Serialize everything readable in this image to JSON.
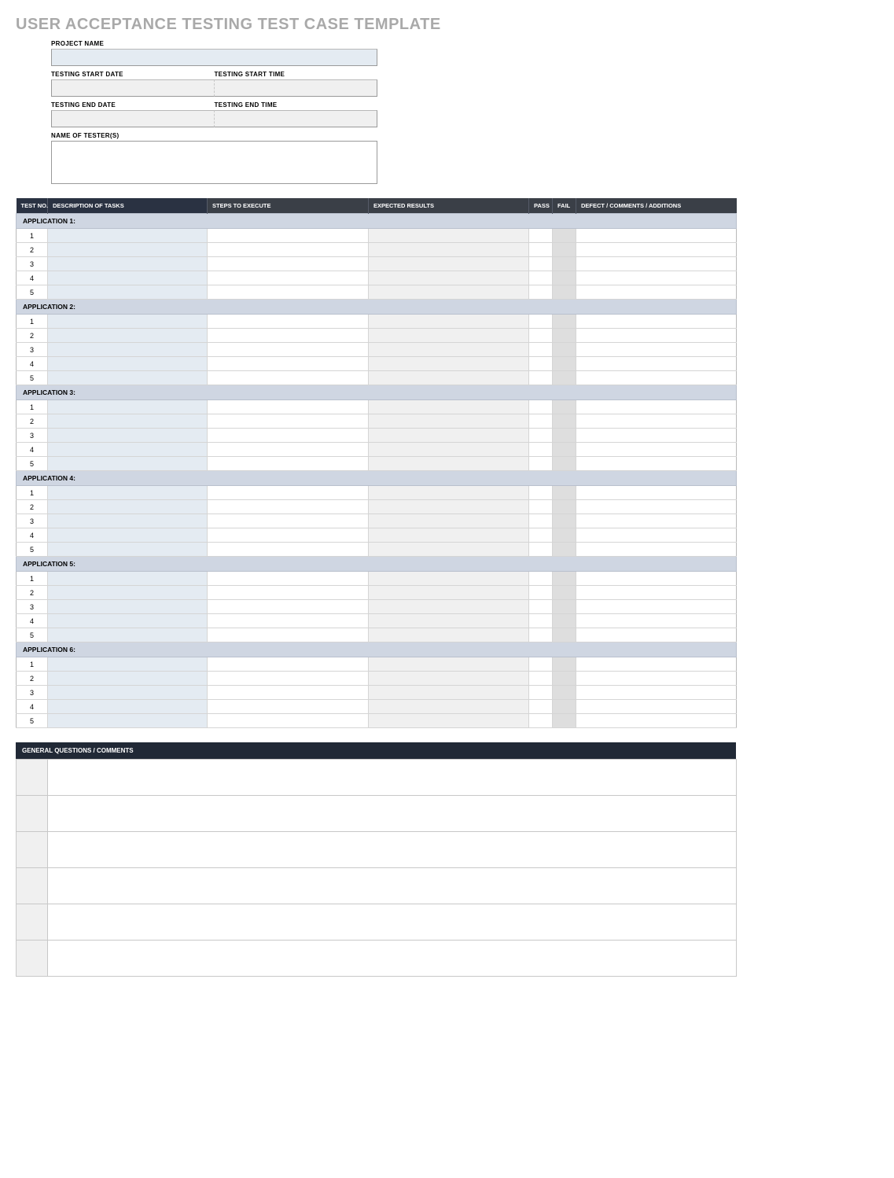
{
  "title": "USER ACCEPTANCE TESTING TEST CASE TEMPLATE",
  "meta": {
    "projectNameLabel": "PROJECT NAME",
    "projectName": "",
    "startDateLabel": "TESTING START DATE",
    "startDate": "",
    "startTimeLabel": "TESTING START TIME",
    "startTime": "",
    "endDateLabel": "TESTING END DATE",
    "endDate": "",
    "endTimeLabel": "TESTING END TIME",
    "endTime": "",
    "testersLabel": "NAME OF TESTER(S)",
    "testers": ""
  },
  "columns": {
    "testNo": "TEST NO.",
    "desc": "DESCRIPTION OF TASKS",
    "steps": "STEPS TO EXECUTE",
    "expected": "EXPECTED RESULTS",
    "pass": "PASS",
    "fail": "FAIL",
    "defect": "DEFECT / COMMENTS / ADDITIONS"
  },
  "applications": [
    {
      "label": "APPLICATION 1:",
      "rows": [
        {
          "no": "1",
          "desc": "",
          "steps": "",
          "exp": "",
          "pass": "",
          "fail": "",
          "def": ""
        },
        {
          "no": "2",
          "desc": "",
          "steps": "",
          "exp": "",
          "pass": "",
          "fail": "",
          "def": ""
        },
        {
          "no": "3",
          "desc": "",
          "steps": "",
          "exp": "",
          "pass": "",
          "fail": "",
          "def": ""
        },
        {
          "no": "4",
          "desc": "",
          "steps": "",
          "exp": "",
          "pass": "",
          "fail": "",
          "def": ""
        },
        {
          "no": "5",
          "desc": "",
          "steps": "",
          "exp": "",
          "pass": "",
          "fail": "",
          "def": ""
        }
      ]
    },
    {
      "label": "APPLICATION 2:",
      "rows": [
        {
          "no": "1",
          "desc": "",
          "steps": "",
          "exp": "",
          "pass": "",
          "fail": "",
          "def": ""
        },
        {
          "no": "2",
          "desc": "",
          "steps": "",
          "exp": "",
          "pass": "",
          "fail": "",
          "def": ""
        },
        {
          "no": "3",
          "desc": "",
          "steps": "",
          "exp": "",
          "pass": "",
          "fail": "",
          "def": ""
        },
        {
          "no": "4",
          "desc": "",
          "steps": "",
          "exp": "",
          "pass": "",
          "fail": "",
          "def": ""
        },
        {
          "no": "5",
          "desc": "",
          "steps": "",
          "exp": "",
          "pass": "",
          "fail": "",
          "def": ""
        }
      ]
    },
    {
      "label": "APPLICATION 3:",
      "rows": [
        {
          "no": "1",
          "desc": "",
          "steps": "",
          "exp": "",
          "pass": "",
          "fail": "",
          "def": ""
        },
        {
          "no": "2",
          "desc": "",
          "steps": "",
          "exp": "",
          "pass": "",
          "fail": "",
          "def": ""
        },
        {
          "no": "3",
          "desc": "",
          "steps": "",
          "exp": "",
          "pass": "",
          "fail": "",
          "def": ""
        },
        {
          "no": "4",
          "desc": "",
          "steps": "",
          "exp": "",
          "pass": "",
          "fail": "",
          "def": ""
        },
        {
          "no": "5",
          "desc": "",
          "steps": "",
          "exp": "",
          "pass": "",
          "fail": "",
          "def": ""
        }
      ]
    },
    {
      "label": "APPLICATION 4:",
      "rows": [
        {
          "no": "1",
          "desc": "",
          "steps": "",
          "exp": "",
          "pass": "",
          "fail": "",
          "def": ""
        },
        {
          "no": "2",
          "desc": "",
          "steps": "",
          "exp": "",
          "pass": "",
          "fail": "",
          "def": ""
        },
        {
          "no": "3",
          "desc": "",
          "steps": "",
          "exp": "",
          "pass": "",
          "fail": "",
          "def": ""
        },
        {
          "no": "4",
          "desc": "",
          "steps": "",
          "exp": "",
          "pass": "",
          "fail": "",
          "def": ""
        },
        {
          "no": "5",
          "desc": "",
          "steps": "",
          "exp": "",
          "pass": "",
          "fail": "",
          "def": ""
        }
      ]
    },
    {
      "label": "APPLICATION 5:",
      "rows": [
        {
          "no": "1",
          "desc": "",
          "steps": "",
          "exp": "",
          "pass": "",
          "fail": "",
          "def": ""
        },
        {
          "no": "2",
          "desc": "",
          "steps": "",
          "exp": "",
          "pass": "",
          "fail": "",
          "def": ""
        },
        {
          "no": "3",
          "desc": "",
          "steps": "",
          "exp": "",
          "pass": "",
          "fail": "",
          "def": ""
        },
        {
          "no": "4",
          "desc": "",
          "steps": "",
          "exp": "",
          "pass": "",
          "fail": "",
          "def": ""
        },
        {
          "no": "5",
          "desc": "",
          "steps": "",
          "exp": "",
          "pass": "",
          "fail": "",
          "def": ""
        }
      ]
    },
    {
      "label": "APPLICATION 6:",
      "rows": [
        {
          "no": "1",
          "desc": "",
          "steps": "",
          "exp": "",
          "pass": "",
          "fail": "",
          "def": ""
        },
        {
          "no": "2",
          "desc": "",
          "steps": "",
          "exp": "",
          "pass": "",
          "fail": "",
          "def": ""
        },
        {
          "no": "3",
          "desc": "",
          "steps": "",
          "exp": "",
          "pass": "",
          "fail": "",
          "def": ""
        },
        {
          "no": "4",
          "desc": "",
          "steps": "",
          "exp": "",
          "pass": "",
          "fail": "",
          "def": ""
        },
        {
          "no": "5",
          "desc": "",
          "steps": "",
          "exp": "",
          "pass": "",
          "fail": "",
          "def": ""
        }
      ]
    }
  ],
  "generalQuestions": {
    "header": "GENERAL QUESTIONS / COMMENTS",
    "rows": [
      {
        "a": "",
        "b": ""
      },
      {
        "a": "",
        "b": ""
      },
      {
        "a": "",
        "b": ""
      },
      {
        "a": "",
        "b": ""
      },
      {
        "a": "",
        "b": ""
      },
      {
        "a": "",
        "b": ""
      }
    ]
  }
}
